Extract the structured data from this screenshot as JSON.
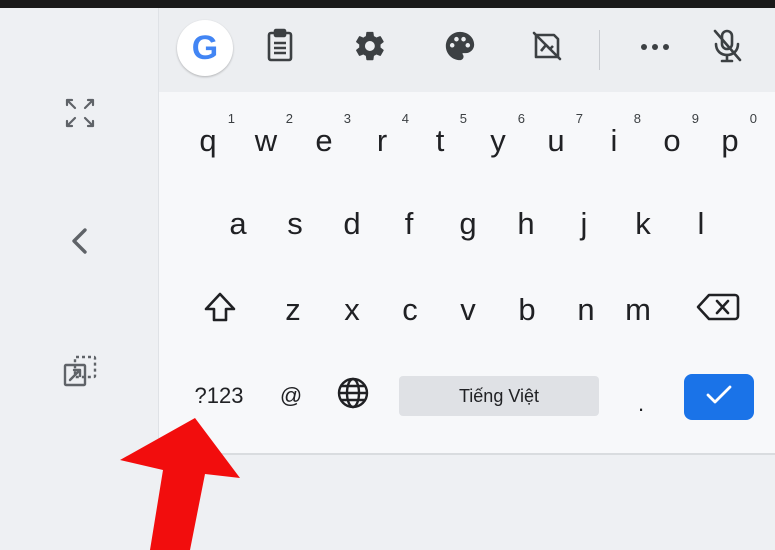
{
  "toolbar": {
    "google_letter": "G",
    "icons": [
      "google-icon",
      "clipboard-icon",
      "settings-gear-icon",
      "theme-palette-icon",
      "no-sticker-icon",
      "more-dots-icon",
      "mic-off-icon"
    ]
  },
  "side_panel": {
    "icons": [
      "expand-arrows-icon",
      "chevron-left-icon",
      "floating-keyboard-icon"
    ]
  },
  "keyboard": {
    "row1": [
      {
        "key": "q",
        "hint": "1"
      },
      {
        "key": "w",
        "hint": "2"
      },
      {
        "key": "e",
        "hint": "3"
      },
      {
        "key": "r",
        "hint": "4"
      },
      {
        "key": "t",
        "hint": "5"
      },
      {
        "key": "y",
        "hint": "6"
      },
      {
        "key": "u",
        "hint": "7"
      },
      {
        "key": "i",
        "hint": "8"
      },
      {
        "key": "o",
        "hint": "9"
      },
      {
        "key": "p",
        "hint": "0"
      }
    ],
    "row2": [
      "a",
      "s",
      "d",
      "f",
      "g",
      "h",
      "j",
      "k",
      "l"
    ],
    "row3": [
      "z",
      "x",
      "c",
      "v",
      "b",
      "n",
      "m"
    ],
    "bottom": {
      "symbols_label": "?123",
      "at_label": "@",
      "space_label": "Tiếng Việt",
      "period_label": "."
    }
  },
  "colors": {
    "enter_key": "#1a73e8",
    "annotation_arrow": "#f20d0d"
  }
}
